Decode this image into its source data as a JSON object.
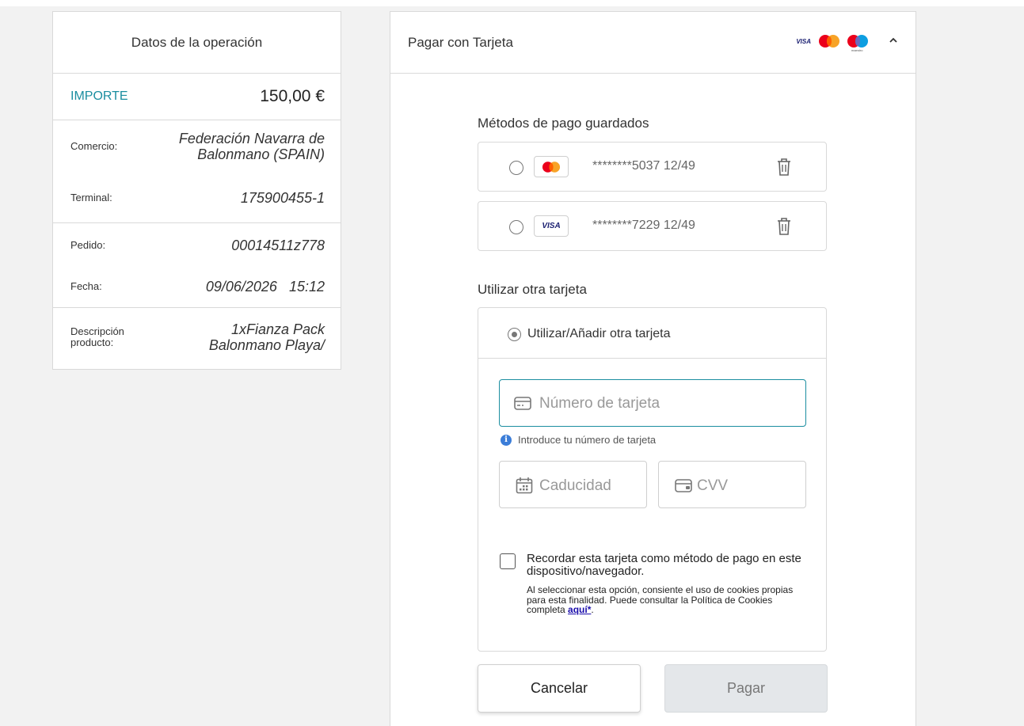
{
  "operation": {
    "title": "Datos de la operación",
    "amount_label": "IMPORTE",
    "amount_value": "150,00 €",
    "merchant_label": "Comercio:",
    "merchant_value_line1": "Federación Navarra de",
    "merchant_value_line2": "Balonmano (SPAIN)",
    "terminal_label": "Terminal:",
    "terminal_value": "175900455-1",
    "order_label": "Pedido:",
    "order_value": "00014511z778",
    "date_label": "Fecha:",
    "date_value": "09/06/2026   15:12",
    "description_label_line1": "Descripción",
    "description_label_line2": "producto:",
    "description_value_line1": "1xFianza Pack",
    "description_value_line2": "Balonmano Playa/"
  },
  "payment": {
    "title": "Pagar con Tarjeta",
    "brand_visa": "VISA",
    "brand_maestro": "maestro",
    "saved_title": "Métodos de pago guardados",
    "saved_cards": [
      {
        "brand": "mastercard",
        "masked": "********5037 12/49"
      },
      {
        "brand": "visa",
        "brand_text": "VISA",
        "masked": "********7229 12/49"
      }
    ],
    "other_title": "Utilizar otra tarjeta",
    "other_option_label": "Utilizar/Añadir otra tarjeta",
    "card_number_placeholder": "Número de tarjeta",
    "card_number_hint": "Introduce tu número de tarjeta",
    "expiry_placeholder": "Caducidad",
    "cvv_placeholder": "CVV",
    "remember_label": "Recordar esta tarjeta como método de pago en este dispositivo/navegador.",
    "consent_text": "Al seleccionar esta opción, consiente el uso de cookies propias para esta finalidad. Puede consultar la Política de Cookies completa",
    "consent_link": "aquí*",
    "consent_end": ".",
    "cancel_label": "Cancelar",
    "pay_label": "Pagar",
    "accent_color": "#1b8ea0"
  }
}
